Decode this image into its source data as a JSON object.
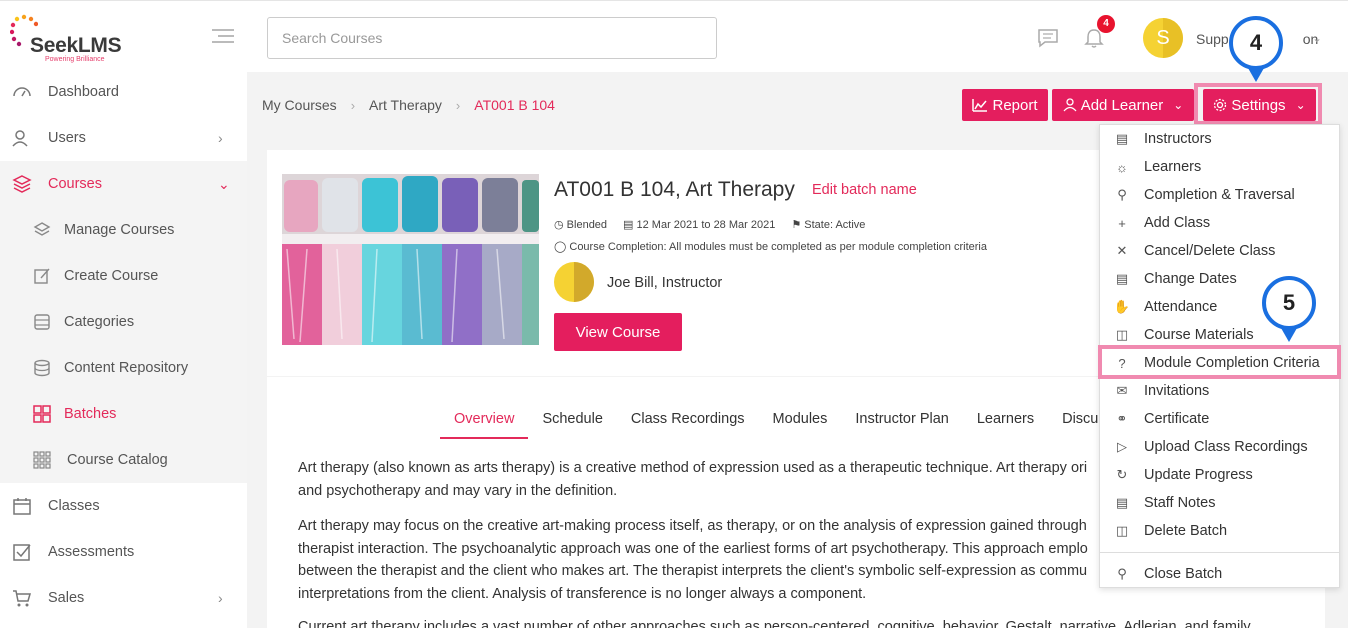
{
  "brand": {
    "name_prefix": "Seek",
    "name_suffix": "LMS",
    "tagline": "Powering Brilliance"
  },
  "search": {
    "placeholder": "Search Courses",
    "value": ""
  },
  "header": {
    "notification_count": "4",
    "user_initial": "S",
    "user_name": "Supp",
    "user_name_tail": "on"
  },
  "sidebar": {
    "items": [
      {
        "label": "Dashboard"
      },
      {
        "label": "Users"
      },
      {
        "label": "Courses"
      },
      {
        "label": "Manage Courses"
      },
      {
        "label": "Create Course"
      },
      {
        "label": "Categories"
      },
      {
        "label": "Content Repository"
      },
      {
        "label": "Batches"
      },
      {
        "label": "Course Catalog"
      },
      {
        "label": "Classes"
      },
      {
        "label": "Assessments"
      },
      {
        "label": "Sales"
      }
    ]
  },
  "breadcrumb": {
    "root": "My Courses",
    "course": "Art Therapy",
    "current": "AT001 B 104"
  },
  "actions": {
    "report": "Report",
    "add_learner": "Add Learner",
    "settings": "Settings"
  },
  "batch": {
    "title": "AT001 B 104, Art Therapy",
    "edit_link": "Edit batch name",
    "mode": "Blended",
    "dates": "12 Mar 2021 to 28 Mar 2021",
    "state": "State: Active",
    "completion": "Course Completion: All modules must be completed as per module completion criteria",
    "instructor": "Joe Bill, Instructor",
    "view_button": "View Course"
  },
  "tabs": [
    "Overview",
    "Schedule",
    "Class Recordings",
    "Modules",
    "Instructor Plan",
    "Learners",
    "Discu"
  ],
  "overview": {
    "p1_l1": "Art therapy (also known as arts therapy) is a creative method of expression used as a therapeutic technique. Art therapy ori",
    "p1_l2": "and psychotherapy and may vary in the definition.",
    "p2_l1": "Art therapy may focus on the creative art-making process itself, as therapy, or on the analysis of expression gained through",
    "p2_l2": "therapist interaction. The psychoanalytic approach was one of the earliest forms of art psychotherapy. This approach emplo",
    "p2_l3": "between the therapist and the client who makes art. The therapist interprets the client's symbolic self-expression as commu",
    "p2_l4": "interpretations from the client. Analysis of transference is no longer always a component.",
    "p3_l1": "Current art therapy includes a vast number of other approaches such as person-centered, cognitive, behavior, Gestalt, narrative, Adlerian, and family"
  },
  "settings_menu": {
    "items": [
      {
        "label": "Instructors",
        "icon": "instructors-icon"
      },
      {
        "label": "Learners",
        "icon": "learners-icon"
      },
      {
        "label": "Completion & Traversal",
        "icon": "trophy-icon"
      },
      {
        "label": "Add Class",
        "icon": "plus-icon"
      },
      {
        "label": "Cancel/Delete Class",
        "icon": "close-icon"
      },
      {
        "label": "Change Dates",
        "icon": "calendar-icon"
      },
      {
        "label": "Attendance",
        "icon": "hand-icon"
      },
      {
        "label": "Course Materials",
        "icon": "book-icon"
      },
      {
        "label": "Module Completion Criteria",
        "icon": "question-icon"
      },
      {
        "label": "Invitations",
        "icon": "envelope-icon"
      },
      {
        "label": "Certificate",
        "icon": "certificate-icon"
      },
      {
        "label": "Upload Class Recordings",
        "icon": "video-icon"
      },
      {
        "label": "Update Progress",
        "icon": "refresh-icon"
      },
      {
        "label": "Staff Notes",
        "icon": "notes-icon"
      },
      {
        "label": "Delete Batch",
        "icon": "trash-icon"
      },
      {
        "label": "Close Batch",
        "icon": "lock-icon"
      }
    ]
  },
  "callouts": {
    "step4": "4",
    "step5": "5"
  },
  "colors": {
    "accent": "#e41e5e",
    "callout": "#1a6fe0",
    "highlight": "#f08ab0"
  }
}
